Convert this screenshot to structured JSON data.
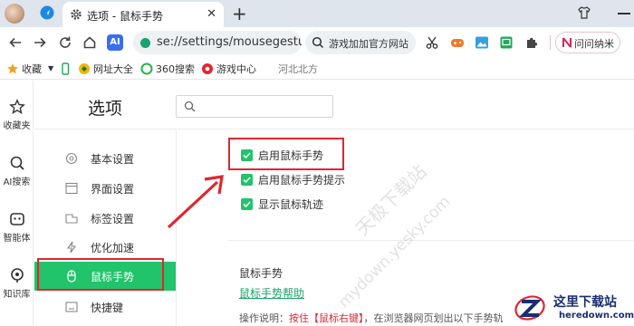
{
  "tab": {
    "title": "选项 - 鼠标手势",
    "close": "✕",
    "new_tab": "+"
  },
  "toolbar": {
    "ai_label": "AI",
    "url": "se://settings/mousegesture",
    "search_text": "游戏加加官方网站",
    "wenwen_label": "问问纳米"
  },
  "bookmarks": [
    {
      "label": "收藏",
      "icon": "star-icon"
    },
    {
      "label": "网址大全",
      "icon": "site-nav-icon"
    },
    {
      "label": "360搜索",
      "icon": "search-360-icon"
    },
    {
      "label": "游戏中心",
      "icon": "game-center-icon"
    },
    {
      "label": "河北北方",
      "icon": "none"
    }
  ],
  "rail": [
    {
      "label": "收藏夹",
      "icon": "star-outline-icon"
    },
    {
      "label": "AI搜索",
      "icon": "ai-search-icon"
    },
    {
      "label": "智能体",
      "icon": "agent-icon"
    },
    {
      "label": "知识库",
      "icon": "knowledge-icon"
    }
  ],
  "page": {
    "title": "选项",
    "search_placeholder": "",
    "nav": [
      {
        "label": "基本设置",
        "icon": "gear-icon",
        "active": false
      },
      {
        "label": "界面设置",
        "icon": "window-icon",
        "active": false
      },
      {
        "label": "标签设置",
        "icon": "tab-icon",
        "active": false
      },
      {
        "label": "优化加速",
        "icon": "lightning-icon",
        "active": false
      },
      {
        "label": "鼠标手势",
        "icon": "mouse-icon",
        "active": true
      },
      {
        "label": "快捷键",
        "icon": "keyboard-icon",
        "active": false
      }
    ],
    "checkboxes": [
      {
        "label": "启用鼠标手势",
        "checked": true
      },
      {
        "label": "启用鼠标手势提示",
        "checked": true
      },
      {
        "label": "显示鼠标轨迹",
        "checked": true
      }
    ],
    "section": {
      "title": "鼠标手势",
      "help_link": "鼠标手势帮助",
      "desc_prefix": "操作说明：",
      "desc_highlight": "按住【鼠标右键】",
      "desc_suffix": "，在浏览器网页划出以下手势轨"
    }
  },
  "watermark": {
    "line1": "天极下载站",
    "line2": "mydown.yesky.com"
  },
  "corner_logo": {
    "name": "这里下载站",
    "url": "heredown.com"
  },
  "colors": {
    "accent_green": "#21c36b",
    "highlight_red": "#e0262f",
    "link_green": "#1aa36b"
  }
}
